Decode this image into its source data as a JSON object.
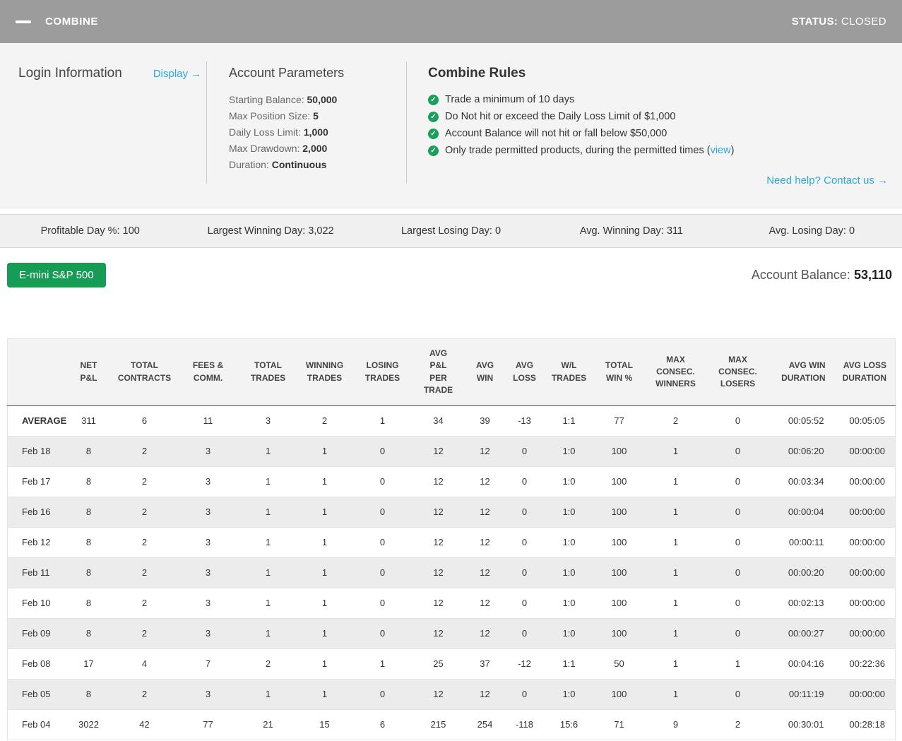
{
  "colors": {
    "accent_blue": "#29a9e2",
    "accent_green": "#169c55",
    "topbar_gray": "#9c9c9c"
  },
  "header": {
    "title": "COMBINE",
    "status_label": "STATUS:",
    "status_value": "CLOSED"
  },
  "login": {
    "title": "Login Information",
    "display_link": "Display →"
  },
  "parameters": {
    "title": "Account Parameters",
    "items": [
      {
        "label": "Starting Balance:",
        "value": "50,000"
      },
      {
        "label": "Max Position Size:",
        "value": "5"
      },
      {
        "label": "Daily Loss Limit:",
        "value": "1,000"
      },
      {
        "label": "Max Drawdown:",
        "value": "2,000"
      },
      {
        "label": "Duration:",
        "value": "Continuous"
      }
    ]
  },
  "rules": {
    "title": "Combine Rules",
    "items": [
      {
        "text": "Trade a minimum of 10 days"
      },
      {
        "text": "Do Not hit or exceed the Daily Loss Limit of $1,000"
      },
      {
        "text": "Account Balance will not hit or fall below $50,000"
      },
      {
        "text": "Only trade permitted products, during the permitted times (",
        "link": "view",
        "suffix": ")"
      }
    ],
    "help_link": "Need help? Contact us →"
  },
  "stats": [
    {
      "label": "Profitable Day %:",
      "value": "100"
    },
    {
      "label": "Largest Winning Day:",
      "value": "3,022"
    },
    {
      "label": "Largest Losing Day:",
      "value": "0"
    },
    {
      "label": "Avg. Winning Day:",
      "value": "311"
    },
    {
      "label": "Avg. Losing Day:",
      "value": "0"
    }
  ],
  "account": {
    "product_button": "E-mini S&P 500",
    "balance_label": "Account Balance:",
    "balance_value": "53,110"
  },
  "table": {
    "headers": [
      "",
      "NET\nP&L",
      "TOTAL\nCONTRACTS",
      "FEES &\nCOMM.",
      "TOTAL\nTRADES",
      "WINNING\nTRADES",
      "LOSING\nTRADES",
      "AVG\nP&L\nPER\nTRADE",
      "AVG\nWIN",
      "AVG\nLOSS",
      "W/L\nTRADES",
      "TOTAL\nWIN %",
      "MAX\nCONSEC.\nWINNERS",
      "MAX\nCONSEC.\nLOSERS",
      "AVG WIN\nDURATION",
      "AVG LOSS\nDURATION"
    ],
    "rows": [
      {
        "label": "AVERAGE",
        "bold": true,
        "cells": [
          "311",
          "6",
          "11",
          "3",
          "2",
          "1",
          "34",
          "39",
          "-13",
          "1:1",
          "77",
          "2",
          "0",
          "00:05:52",
          "00:05:05"
        ]
      },
      {
        "label": "Feb 18",
        "cells": [
          "8",
          "2",
          "3",
          "1",
          "1",
          "0",
          "12",
          "12",
          "0",
          "1:0",
          "100",
          "1",
          "0",
          "00:06:20",
          "00:00:00"
        ]
      },
      {
        "label": "Feb 17",
        "cells": [
          "8",
          "2",
          "3",
          "1",
          "1",
          "0",
          "12",
          "12",
          "0",
          "1:0",
          "100",
          "1",
          "0",
          "00:03:34",
          "00:00:00"
        ]
      },
      {
        "label": "Feb 16",
        "cells": [
          "8",
          "2",
          "3",
          "1",
          "1",
          "0",
          "12",
          "12",
          "0",
          "1:0",
          "100",
          "1",
          "0",
          "00:00:04",
          "00:00:00"
        ]
      },
      {
        "label": "Feb 12",
        "cells": [
          "8",
          "2",
          "3",
          "1",
          "1",
          "0",
          "12",
          "12",
          "0",
          "1:0",
          "100",
          "1",
          "0",
          "00:00:11",
          "00:00:00"
        ]
      },
      {
        "label": "Feb 11",
        "cells": [
          "8",
          "2",
          "3",
          "1",
          "1",
          "0",
          "12",
          "12",
          "0",
          "1:0",
          "100",
          "1",
          "0",
          "00:00:20",
          "00:00:00"
        ]
      },
      {
        "label": "Feb 10",
        "cells": [
          "8",
          "2",
          "3",
          "1",
          "1",
          "0",
          "12",
          "12",
          "0",
          "1:0",
          "100",
          "1",
          "0",
          "00:02:13",
          "00:00:00"
        ]
      },
      {
        "label": "Feb 09",
        "cells": [
          "8",
          "2",
          "3",
          "1",
          "1",
          "0",
          "12",
          "12",
          "0",
          "1:0",
          "100",
          "1",
          "0",
          "00:00:27",
          "00:00:00"
        ]
      },
      {
        "label": "Feb 08",
        "cells": [
          "17",
          "4",
          "7",
          "2",
          "1",
          "1",
          "25",
          "37",
          "-12",
          "1:1",
          "50",
          "1",
          "1",
          "00:04:16",
          "00:22:36"
        ]
      },
      {
        "label": "Feb 05",
        "cells": [
          "8",
          "2",
          "3",
          "1",
          "1",
          "0",
          "12",
          "12",
          "0",
          "1:0",
          "100",
          "1",
          "0",
          "00:11:19",
          "00:00:00"
        ]
      },
      {
        "label": "Feb 04",
        "cells": [
          "3022",
          "42",
          "77",
          "21",
          "15",
          "6",
          "215",
          "254",
          "-118",
          "15:6",
          "71",
          "9",
          "2",
          "00:30:01",
          "00:28:18"
        ]
      }
    ]
  }
}
